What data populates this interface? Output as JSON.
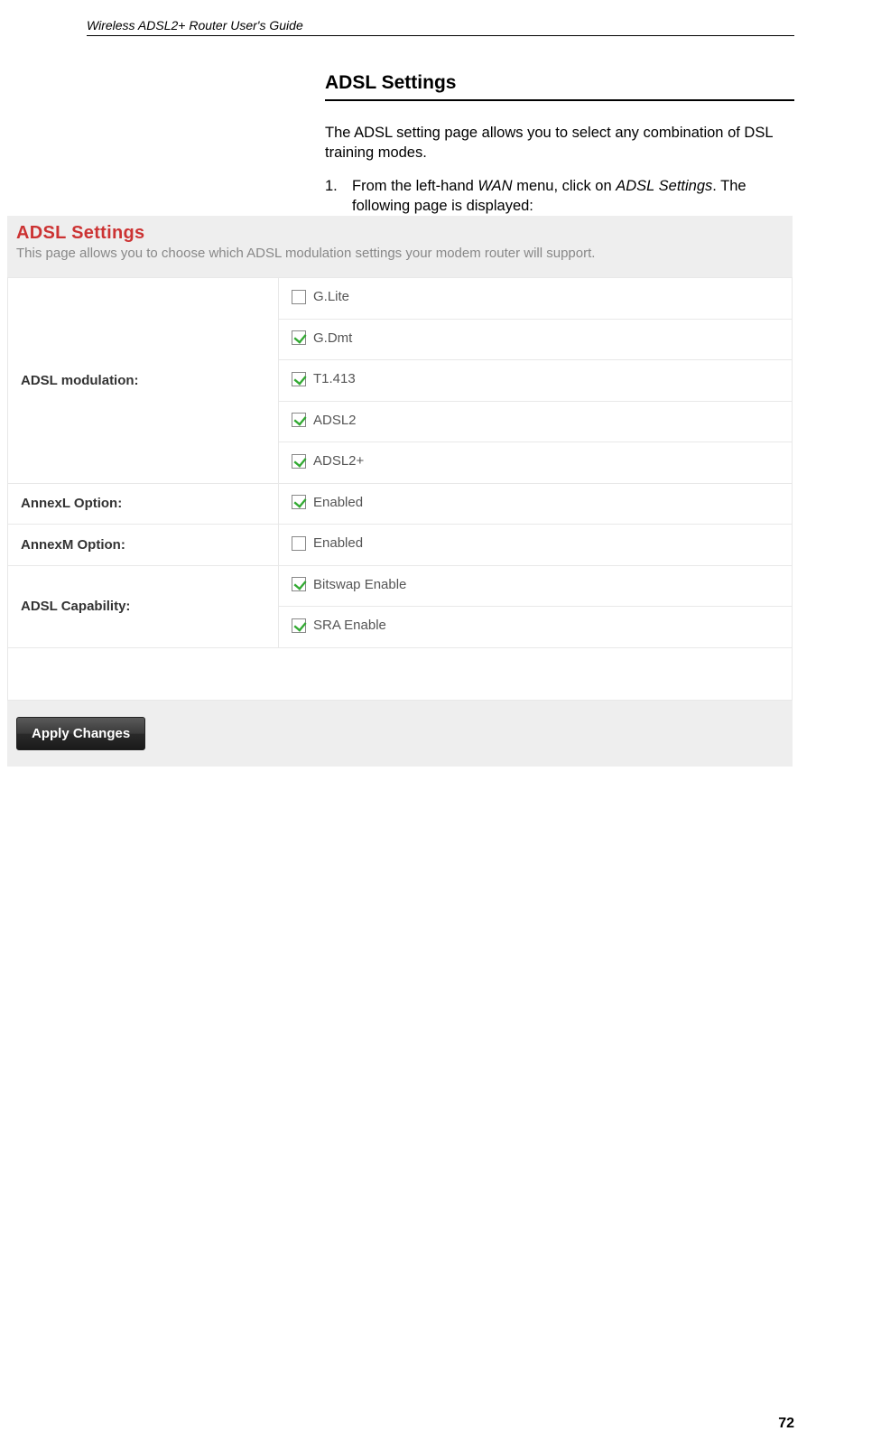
{
  "header": {
    "title": "Wireless ADSL2+ Router User's Guide"
  },
  "section": {
    "title": "ADSL Settings",
    "intro": "The ADSL setting page allows you to select any combination of DSL training modes.",
    "step_num": "1.",
    "step_prefix": "From the left-hand ",
    "step_wan": "WAN",
    "step_mid": " menu, click on ",
    "step_adsl": "ADSL Settings",
    "step_suffix": ". The following page is displayed:"
  },
  "screenshot": {
    "title": "ADSL Settings",
    "subtitle": "This page allows you to choose which ADSL modulation settings your modem router will support.",
    "rows": {
      "modulation_label": "ADSL modulation:",
      "annexl_label": "AnnexL Option:",
      "annexm_label": "AnnexM Option:",
      "capability_label": "ADSL Capability:"
    },
    "options": {
      "glite": "G.Lite",
      "gdmt": "G.Dmt",
      "t1413": "T1.413",
      "adsl2": "ADSL2",
      "adsl2p": "ADSL2+",
      "annexl_enabled": "Enabled",
      "annexm_enabled": "Enabled",
      "bitswap": "Bitswap Enable",
      "sra": "SRA Enable"
    },
    "checked": {
      "glite": false,
      "gdmt": true,
      "t1413": true,
      "adsl2": true,
      "adsl2p": true,
      "annexl": true,
      "annexm": false,
      "bitswap": true,
      "sra": true
    },
    "button": "Apply Changes"
  },
  "page_number": "72"
}
